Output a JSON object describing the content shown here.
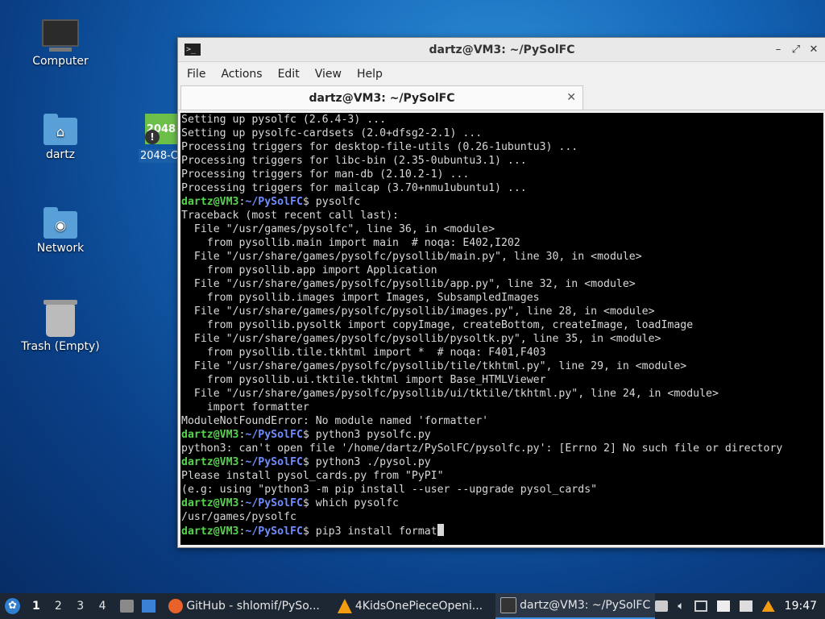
{
  "desktop": {
    "icons": [
      {
        "label": "Computer"
      },
      {
        "label": "dartz"
      },
      {
        "label": "Network"
      },
      {
        "label": "Trash (Empty)"
      }
    ],
    "partial_icon": {
      "tile_text": "2048",
      "label": "2048-C"
    }
  },
  "window": {
    "title": "dartz@VM3: ~/PySolFC",
    "menu": [
      "File",
      "Actions",
      "Edit",
      "View",
      "Help"
    ],
    "tab_title": "dartz@VM3: ~/PySolFC"
  },
  "terminal": {
    "prompt_user": "dartz@VM3",
    "prompt_sep": ":",
    "prompt_path": "~/PySolFC",
    "prompt_end": "$ ",
    "lines": [
      {
        "text": "Setting up pysolfc (2.6.4-3) ..."
      },
      {
        "text": "Setting up pysolfc-cardsets (2.0+dfsg2-2.1) ..."
      },
      {
        "text": "Processing triggers for desktop-file-utils (0.26-1ubuntu3) ..."
      },
      {
        "text": "Processing triggers for libc-bin (2.35-0ubuntu3.1) ..."
      },
      {
        "text": "Processing triggers for man-db (2.10.2-1) ..."
      },
      {
        "text": "Processing triggers for mailcap (3.70+nmu1ubuntu1) ..."
      },
      {
        "prompt": true,
        "text": "pysolfc"
      },
      {
        "text": "Traceback (most recent call last):"
      },
      {
        "text": "  File \"/usr/games/pysolfc\", line 36, in <module>"
      },
      {
        "text": "    from pysollib.main import main  # noqa: E402,I202"
      },
      {
        "text": "  File \"/usr/share/games/pysolfc/pysollib/main.py\", line 30, in <module>"
      },
      {
        "text": "    from pysollib.app import Application"
      },
      {
        "text": "  File \"/usr/share/games/pysolfc/pysollib/app.py\", line 32, in <module>"
      },
      {
        "text": "    from pysollib.images import Images, SubsampledImages"
      },
      {
        "text": "  File \"/usr/share/games/pysolfc/pysollib/images.py\", line 28, in <module>"
      },
      {
        "text": "    from pysollib.pysoltk import copyImage, createBottom, createImage, loadImage"
      },
      {
        "text": "  File \"/usr/share/games/pysolfc/pysollib/pysoltk.py\", line 35, in <module>"
      },
      {
        "text": "    from pysollib.tile.tkhtml import *  # noqa: F401,F403"
      },
      {
        "text": "  File \"/usr/share/games/pysolfc/pysollib/tile/tkhtml.py\", line 29, in <module>"
      },
      {
        "text": "    from pysollib.ui.tktile.tkhtml import Base_HTMLViewer"
      },
      {
        "text": "  File \"/usr/share/games/pysolfc/pysollib/ui/tktile/tkhtml.py\", line 24, in <module>"
      },
      {
        "text": "    import formatter"
      },
      {
        "text": "ModuleNotFoundError: No module named 'formatter'"
      },
      {
        "prompt": true,
        "text": "python3 pysolfc.py"
      },
      {
        "text": "python3: can't open file '/home/dartz/PySolFC/pysolfc.py': [Errno 2] No such file or directory"
      },
      {
        "prompt": true,
        "text": "python3 ./pysol.py"
      },
      {
        "text": "Please install pysol_cards.py from \"PyPI\""
      },
      {
        "text": "(e.g: using \"python3 -m pip install --user --upgrade pysol_cards\""
      },
      {
        "prompt": true,
        "text": "which pysolfc"
      },
      {
        "text": "/usr/games/pysolfc"
      },
      {
        "prompt": true,
        "text": "pip3 install format",
        "cursor": true
      }
    ]
  },
  "taskbar": {
    "workspaces": [
      "1",
      "2",
      "3",
      "4"
    ],
    "tasks": [
      {
        "label": "GitHub - shlomif/PySo...",
        "icon": "firefox-icon",
        "color": "#e8632b"
      },
      {
        "label": "4KidsOnePieceOpeni...",
        "icon": "vlc-icon",
        "color": "#f39c12"
      },
      {
        "label": "dartz@VM3: ~/PySolFC",
        "icon": "terminal-icon",
        "color": "#333333"
      }
    ],
    "clock": "19:47"
  }
}
